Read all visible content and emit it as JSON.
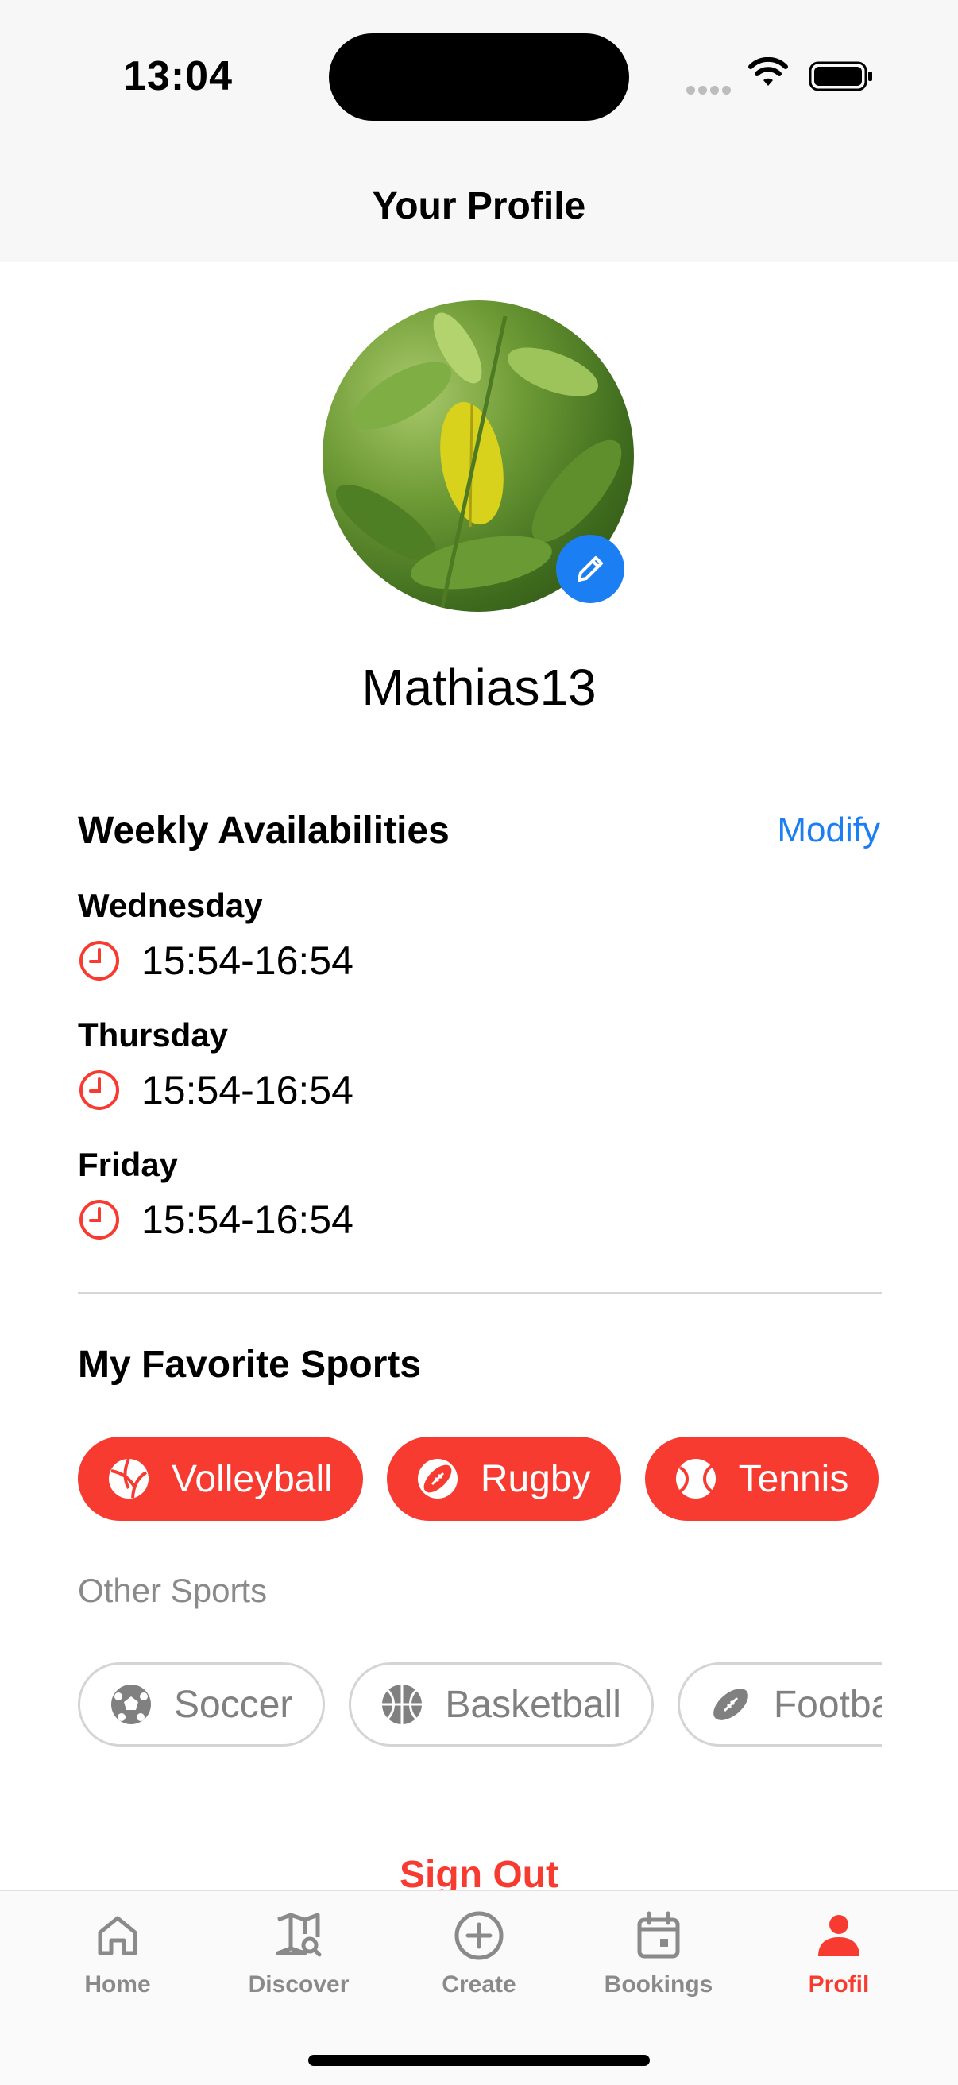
{
  "status_bar": {
    "time": "13:04"
  },
  "header": {
    "title": "Your Profile"
  },
  "profile": {
    "username": "Mathias13"
  },
  "availability": {
    "title": "Weekly Availabilities",
    "modify_label": "Modify",
    "days": [
      {
        "day": "Wednesday",
        "time": "15:54-16:54"
      },
      {
        "day": "Thursday",
        "time": "15:54-16:54"
      },
      {
        "day": "Friday",
        "time": "15:54-16:54"
      }
    ]
  },
  "sports": {
    "title": "My Favorite Sports",
    "favorites": [
      {
        "label": "Volleyball",
        "icon": "volleyball-icon"
      },
      {
        "label": "Rugby",
        "icon": "rugby-ball-icon"
      },
      {
        "label": "Tennis",
        "icon": "tennis-ball-icon"
      }
    ],
    "other_label": "Other Sports",
    "others": [
      {
        "label": "Soccer",
        "icon": "soccer-ball-icon"
      },
      {
        "label": "Basketball",
        "icon": "basketball-icon"
      },
      {
        "label": "Football",
        "icon": "american-football-icon"
      }
    ]
  },
  "sign_out_label": "Sign Out",
  "tabs": [
    {
      "label": "Home",
      "icon": "house-icon"
    },
    {
      "label": "Discover",
      "icon": "map-search-icon"
    },
    {
      "label": "Create",
      "icon": "plus-circle-icon"
    },
    {
      "label": "Bookings",
      "icon": "calendar-icon"
    },
    {
      "label": "Profil",
      "icon": "person-icon",
      "active": true
    }
  ],
  "colors": {
    "accent": "#f73b30",
    "link": "#1c7ef3"
  }
}
